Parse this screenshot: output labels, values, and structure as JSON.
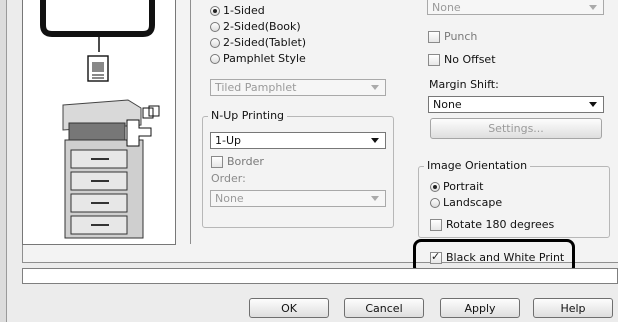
{
  "print_sides": {
    "options": [
      {
        "label": "1-Sided",
        "selected": true
      },
      {
        "label": "2-Sided(Book)",
        "selected": false
      },
      {
        "label": "2-Sided(Tablet)",
        "selected": false
      },
      {
        "label": "Pamphlet Style",
        "selected": false
      }
    ],
    "pamphlet_select_value": "Tiled Pamphlet"
  },
  "nup": {
    "legend": "N-Up Printing",
    "select_value": "1-Up",
    "border_label": "Border",
    "order_label": "Order:",
    "order_value": "None"
  },
  "finishing": {
    "top_select_value": "None",
    "punch_label": "Punch",
    "no_offset_label": "No Offset",
    "margin_shift_label": "Margin Shift:",
    "margin_shift_value": "None",
    "settings_button": "Settings..."
  },
  "orientation": {
    "legend": "Image Orientation",
    "options": [
      {
        "label": "Portrait",
        "selected": true
      },
      {
        "label": "Landscape",
        "selected": false
      }
    ],
    "rotate_label": "Rotate 180 degrees",
    "rotate_checked": false
  },
  "bw_print": {
    "label": "Black and White Print",
    "checked": true
  },
  "buttons": {
    "ok": "OK",
    "cancel": "Cancel",
    "apply": "Apply",
    "help": "Help"
  }
}
